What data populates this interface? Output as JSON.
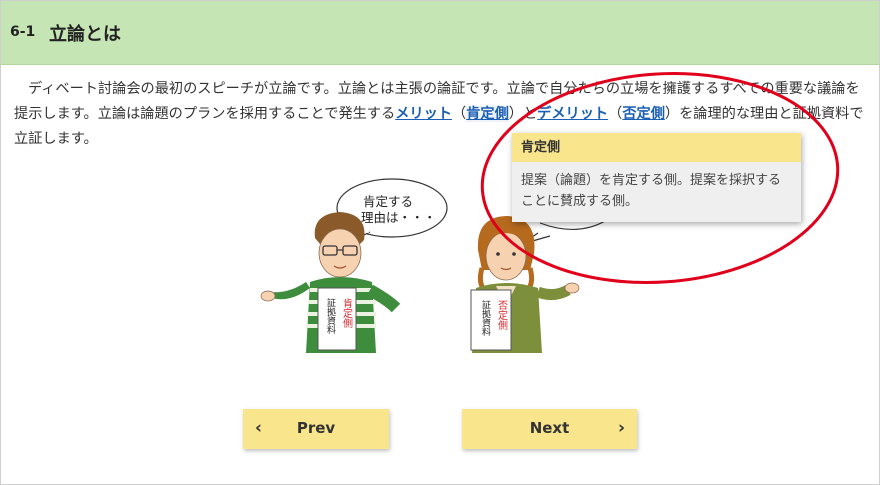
{
  "header": {
    "section_number": "6-1",
    "title": "立論とは"
  },
  "body": {
    "part1": "ディベート討論会の最初のスピーチが立論です。立論とは主張の論証です。立論で自分たちの立場を擁護するすべての重要な議論を提示します。立論は論題のプランを採用することで発生する",
    "term_merit": "メリット",
    "paren_open_1": "（",
    "term_affirmative": "肯定側",
    "paren_close_1": "）",
    "to": "と",
    "term_demerit": "デメリット",
    "paren_open_2": "（",
    "term_negative": "否定側",
    "paren_close_2": "）",
    "part2": "を論理的な理由と証拠資料で立証します。"
  },
  "tooltip": {
    "title": "肯定側",
    "text": "提案（論題）を肯定する側。提案を採択することに賛成する側。"
  },
  "illustration": {
    "speech_bubble": [
      "肯定する",
      "理由は・・・"
    ],
    "affirmative_card": [
      "肯定側",
      "証拠資料"
    ],
    "negative_card": [
      "否定側",
      "証拠資料"
    ]
  },
  "nav": {
    "prev_label": "Prev",
    "next_label": "Next",
    "prev_icon": "chevron-left-icon",
    "next_icon": "chevron-right-icon"
  },
  "colors": {
    "header_bg": "#c5e5b4",
    "link": "#1a5fb4",
    "tooltip_header": "#f8e58c",
    "button": "#f8e58c",
    "highlight_circle": "#e0001b"
  }
}
